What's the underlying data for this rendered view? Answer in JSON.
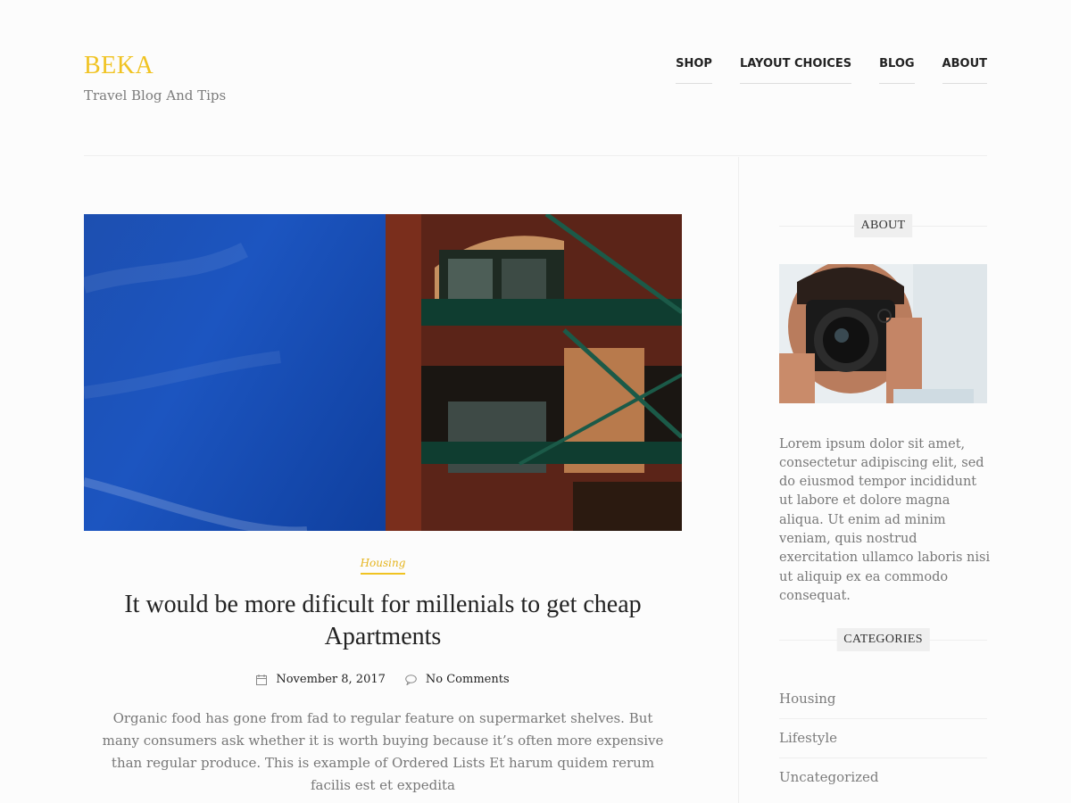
{
  "site": {
    "title": "BEKA",
    "tagline": "Travel Blog And Tips"
  },
  "nav": {
    "items": [
      {
        "label": "SHOP"
      },
      {
        "label": "LAYOUT CHOICES"
      },
      {
        "label": "BLOG"
      },
      {
        "label": "ABOUT"
      }
    ]
  },
  "post": {
    "category": "Housing",
    "title": "It would be more dificult for millenials to get cheap Apartments",
    "date": "November 8, 2017",
    "comments": "No Comments",
    "excerpt": "Organic food has gone from fad to regular feature on supermarket shelves. But many consumers ask whether it is worth buying because it’s often more expensive than regular produce. This is example of Ordered Lists Et harum quidem rerum facilis est et expedita"
  },
  "sidebar": {
    "about": {
      "title": "ABOUT",
      "text": "Lorem ipsum dolor sit amet, consectetur adipiscing elit, sed do eiusmod tempor incididunt ut labore et dolore magna aliqua. Ut enim ad minim veniam, quis nostrud exercitation ullamco laboris nisi ut aliquip ex ea commodo consequat."
    },
    "categories": {
      "title": "CATEGORIES",
      "items": [
        {
          "label": "Housing"
        },
        {
          "label": "Lifestyle"
        },
        {
          "label": "Uncategorized"
        }
      ]
    }
  },
  "colors": {
    "accent": "#f0c322",
    "text_muted": "#7b7b7b"
  }
}
